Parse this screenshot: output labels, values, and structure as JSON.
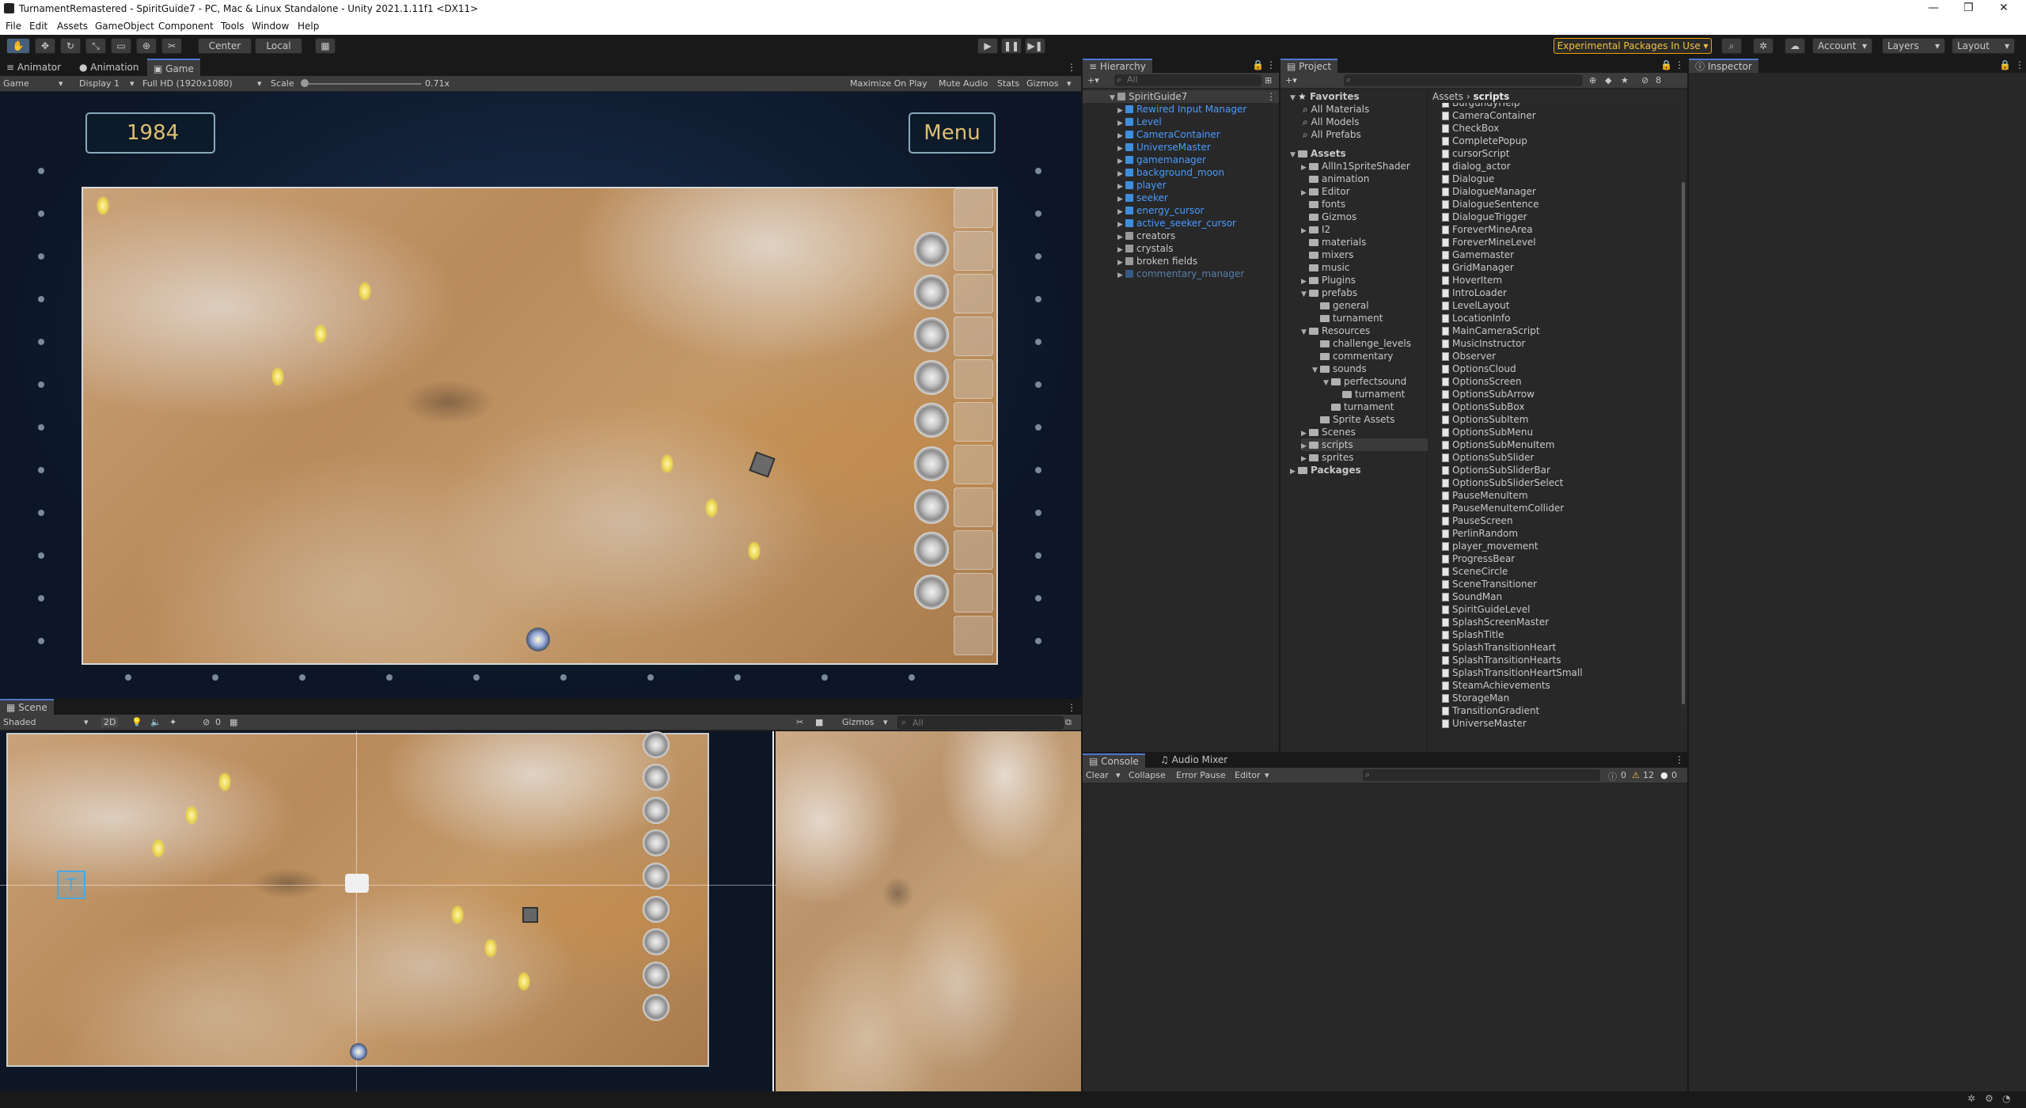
{
  "titlebar": {
    "title": "TurnamentRemastered - SpiritGuide7 - PC, Mac & Linux Standalone - Unity 2021.1.11f1 <DX11>"
  },
  "menu": [
    "File",
    "Edit",
    "Assets",
    "GameObject",
    "Component",
    "Tools",
    "Window",
    "Help"
  ],
  "toolbar": {
    "center": "Center",
    "local": "Local",
    "experimental": "Experimental Packages In Use ▾",
    "account": "Account",
    "layers": "Layers",
    "layout": "Layout"
  },
  "game_panel": {
    "tabs": [
      "Animator",
      "Animation",
      "Game"
    ],
    "mode": "Game",
    "display": "Display 1",
    "resolution": "Full HD (1920x1080)",
    "scale_label": "Scale",
    "scale_value": "0.71x",
    "maximize": "Maximize On Play",
    "mute": "Mute Audio",
    "stats": "Stats",
    "gizmos": "Gizmos",
    "year": "1984",
    "menu_button": "Menu"
  },
  "scene_panel": {
    "tab": "Scene",
    "shading": "Shaded",
    "mode2d": "2D",
    "hidden_count": "0",
    "gizmos": "Gizmos",
    "search_placeholder": "All"
  },
  "hierarchy": {
    "tab": "Hierarchy",
    "search_placeholder": "All",
    "root": "SpiritGuide7",
    "items": [
      {
        "label": "Rewired Input Manager",
        "style": "blue"
      },
      {
        "label": "Level",
        "style": "blue"
      },
      {
        "label": "CameraContainer",
        "style": "blue"
      },
      {
        "label": "UniverseMaster",
        "style": "blue"
      },
      {
        "label": "gamemanager",
        "style": "blue"
      },
      {
        "label": "background_moon",
        "style": "blue"
      },
      {
        "label": "player",
        "style": "blue"
      },
      {
        "label": "seeker",
        "style": "blue"
      },
      {
        "label": "energy_cursor",
        "style": "blue"
      },
      {
        "label": "active_seeker_cursor",
        "style": "blue"
      },
      {
        "label": "creators",
        "style": "plain"
      },
      {
        "label": "crystals",
        "style": "plain"
      },
      {
        "label": "broken fields",
        "style": "plain"
      },
      {
        "label": "commentary_manager",
        "style": "dim"
      }
    ]
  },
  "project": {
    "tab": "Project",
    "hidden_count": "8",
    "breadcrumb_root": "Assets",
    "breadcrumb_sep": "›",
    "breadcrumb_current": "scripts",
    "favorites_label": "Favorites",
    "favorites": [
      "All Materials",
      "All Models",
      "All Prefabs"
    ],
    "assets_label": "Assets",
    "tree": [
      {
        "label": "AllIn1SpriteShader",
        "indent": 1
      },
      {
        "label": "animation",
        "indent": 1
      },
      {
        "label": "Editor",
        "indent": 1
      },
      {
        "label": "fonts",
        "indent": 1
      },
      {
        "label": "Gizmos",
        "indent": 1
      },
      {
        "label": "I2",
        "indent": 1
      },
      {
        "label": "materials",
        "indent": 1
      },
      {
        "label": "mixers",
        "indent": 1
      },
      {
        "label": "music",
        "indent": 1
      },
      {
        "label": "Plugins",
        "indent": 1
      },
      {
        "label": "prefabs",
        "indent": 1
      },
      {
        "label": "general",
        "indent": 2
      },
      {
        "label": "turnament",
        "indent": 2
      },
      {
        "label": "Resources",
        "indent": 1
      },
      {
        "label": "challenge_levels",
        "indent": 2
      },
      {
        "label": "commentary",
        "indent": 2
      },
      {
        "label": "sounds",
        "indent": 2
      },
      {
        "label": "perfectsound",
        "indent": 3
      },
      {
        "label": "turnament",
        "indent": 4
      },
      {
        "label": "turnament",
        "indent": 3
      },
      {
        "label": "Sprite Assets",
        "indent": 2
      },
      {
        "label": "Scenes",
        "indent": 1
      },
      {
        "label": "scripts",
        "indent": 1,
        "selected": true
      },
      {
        "label": "sprites",
        "indent": 1
      }
    ],
    "packages_label": "Packages",
    "scripts": [
      "BurgundyHelp",
      "CameraContainer",
      "CheckBox",
      "CompletePopup",
      "cursorScript",
      "dialog_actor",
      "Dialogue",
      "DialogueManager",
      "DialogueSentence",
      "DialogueTrigger",
      "ForeverMineArea",
      "ForeverMineLevel",
      "Gamemaster",
      "GridManager",
      "HoverItem",
      "IntroLoader",
      "LevelLayout",
      "LocationInfo",
      "MainCameraScript",
      "MusicInstructor",
      "Observer",
      "OptionsCloud",
      "OptionsScreen",
      "OptionsSubArrow",
      "OptionsSubBox",
      "OptionsSubItem",
      "OptionsSubMenu",
      "OptionsSubMenuItem",
      "OptionsSubSlider",
      "OptionsSubSliderBar",
      "OptionsSubSliderSelect",
      "PauseMenuItem",
      "PauseMenuItemCollider",
      "PauseScreen",
      "PerlinRandom",
      "player_movement",
      "ProgressBear",
      "SceneCircle",
      "SceneTransitioner",
      "SoundMan",
      "SpiritGuideLevel",
      "SplashScreenMaster",
      "SplashTitle",
      "SplashTransitionHeart",
      "SplashTransitionHearts",
      "SplashTransitionHeartSmall",
      "SteamAchievements",
      "StorageMan",
      "TransitionGradient",
      "UniverseMaster"
    ]
  },
  "console": {
    "tabs": [
      "Console",
      "Audio Mixer"
    ],
    "clear": "Clear",
    "collapse": "Collapse",
    "error_pause": "Error Pause",
    "editor": "Editor",
    "errors": "0",
    "warnings": "12",
    "infos": "0"
  },
  "inspector": {
    "tab": "Inspector"
  },
  "colors": {
    "accent": "#4d78cc",
    "link": "#4a9bff",
    "experimental": "#f0a000",
    "gold": "#e0c070"
  }
}
